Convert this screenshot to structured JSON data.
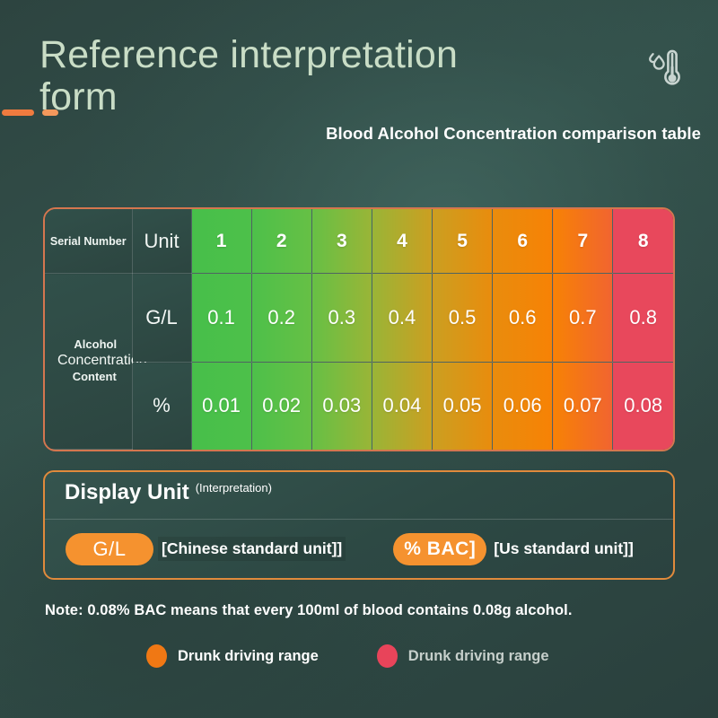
{
  "header": {
    "title": "Reference interpretation form",
    "subtitle": "Blood Alcohol Concentration comparison table",
    "icon": "thermometer-droplet-icon"
  },
  "table": {
    "label_column_header": "Serial Number",
    "unit_column_header": "Unit",
    "row_label_parts": {
      "line1": "Alcohol",
      "line2": "Concentration",
      "line3": "Content"
    },
    "serial_numbers": [
      "1",
      "2",
      "3",
      "4",
      "5",
      "6",
      "7",
      "8"
    ],
    "rows": [
      {
        "unit": "G/L",
        "values": [
          "0.1",
          "0.2",
          "0.3",
          "0.4",
          "0.5",
          "0.6",
          "0.7",
          "0.8"
        ]
      },
      {
        "unit": "%",
        "values": [
          "0.01",
          "0.02",
          "0.03",
          "0.04",
          "0.05",
          "0.06",
          "0.07",
          "0.08"
        ]
      }
    ],
    "column_colors": [
      "#47bf4a",
      "#52c04a",
      "#79bf3f",
      "#b8ab2e",
      "#dd9213",
      "#f58507",
      "#f97f03",
      "#e8485c"
    ],
    "border_color": "#d4764f"
  },
  "display_panel": {
    "title": "Display Unit",
    "subtitle": "(Interpretation)",
    "options": [
      {
        "pill": "G/L",
        "description": "[Chinese standard unit]]"
      },
      {
        "pill": "% BAC]",
        "description": "[Us standard unit]]"
      }
    ],
    "border_color": "#e08a3c",
    "pill_color": "#f5922f"
  },
  "note": "Note: 0.08% BAC means that every 100ml of blood contains 0.08g alcohol.",
  "legend": [
    {
      "label": "Drunk driving range",
      "color": "#f07814"
    },
    {
      "label": "Drunk driving range",
      "color": "#e8445a"
    }
  ],
  "chart_data": {
    "type": "table",
    "title": "Blood Alcohol Concentration comparison table",
    "categories": [
      "1",
      "2",
      "3",
      "4",
      "5",
      "6",
      "7",
      "8"
    ],
    "series": [
      {
        "name": "G/L",
        "values": [
          0.1,
          0.2,
          0.3,
          0.4,
          0.5,
          0.6,
          0.7,
          0.8
        ]
      },
      {
        "name": "%",
        "values": [
          0.01,
          0.02,
          0.03,
          0.04,
          0.05,
          0.06,
          0.07,
          0.08
        ]
      }
    ],
    "xlabel": "Serial Number",
    "ylabel": "Alcohol Concentration Content",
    "colorscale": [
      "#47bf4a",
      "#52c04a",
      "#79bf3f",
      "#b8ab2e",
      "#dd9213",
      "#f58507",
      "#f97f03",
      "#e8485c"
    ]
  }
}
